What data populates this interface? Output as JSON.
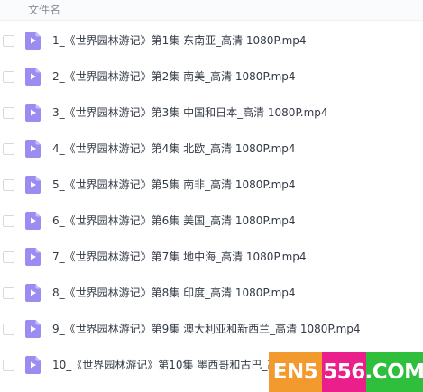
{
  "header": {
    "column_label": "文件名"
  },
  "files": [
    {
      "name": "1_《世界园林游记》第1集 东南亚_高清 1080P.mp4"
    },
    {
      "name": "2_《世界园林游记》第2集 南美_高清 1080P.mp4"
    },
    {
      "name": "3_《世界园林游记》第3集 中国和日本_高清 1080P.mp4"
    },
    {
      "name": "4_《世界园林游记》第4集 北欧_高清 1080P.mp4"
    },
    {
      "name": "5_《世界园林游记》第5集 南非_高清 1080P.mp4"
    },
    {
      "name": "6_《世界园林游记》第6集 美国_高清 1080P.mp4"
    },
    {
      "name": "7_《世界园林游记》第7集 地中海_高清 1080P.mp4"
    },
    {
      "name": "8_《世界园林游记》第8集 印度_高清 1080P.mp4"
    },
    {
      "name": "9_《世界园林游记》第9集 澳大利亚和新西兰_高清 1080P.mp4"
    },
    {
      "name": "10_《世界园林游记》第10集 墨西哥和古巴_高"
    }
  ],
  "watermark": {
    "part1": "EN5",
    "part2": "556",
    "part3": ".COM"
  },
  "colors": {
    "icon": "#9a8cf0",
    "watermark_orange": "#f29a2e",
    "watermark_pink": "#ea1f8c",
    "watermark_green": "#2fbf3c"
  },
  "icons": {
    "file": "video-file-icon"
  }
}
